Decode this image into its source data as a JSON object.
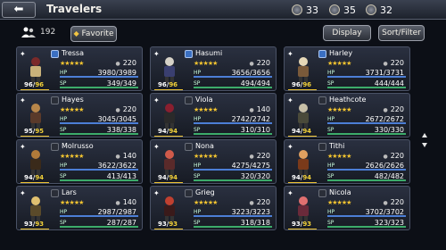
{
  "header": {
    "back_label": "⬅",
    "title": "Travelers",
    "resources": [
      {
        "name": "rank",
        "value": "33",
        "sub": "RANK"
      },
      {
        "name": "guild",
        "value": "35",
        "sub": "RANK"
      },
      {
        "name": "gems",
        "value": "32",
        "sub": "RANK"
      }
    ]
  },
  "toolbar": {
    "count": "192",
    "favorite_label": "Favorite",
    "display_label": "Display",
    "sort_label": "Sort/Filter"
  },
  "labels": {
    "hp": "HP",
    "sp": "SP"
  },
  "travelers": [
    {
      "name": "Tressa",
      "stars": "★★★★★",
      "level": "220",
      "lv": "96",
      "lvmax": "96",
      "hp": "3980/3989",
      "sp": "349/349",
      "weapon": "blue"
    },
    {
      "name": "Hasumi",
      "stars": "★★★★★",
      "level": "220",
      "lv": "96",
      "lvmax": "96",
      "hp": "3656/3656",
      "sp": "494/494",
      "weapon": "blue"
    },
    {
      "name": "Harley",
      "stars": "★★★★★",
      "level": "220",
      "lv": "96",
      "lvmax": "96",
      "hp": "3731/3731",
      "sp": "444/444",
      "weapon": "blue"
    },
    {
      "name": "Hayes",
      "stars": "★★★★★",
      "level": "220",
      "lv": "95",
      "lvmax": "95",
      "hp": "3045/3045",
      "sp": "338/338",
      "weapon": "dark"
    },
    {
      "name": "Viola",
      "stars": "★★★★★",
      "level": "140",
      "lv": "94",
      "lvmax": "94",
      "hp": "2742/2742",
      "sp": "310/310",
      "weapon": "dark"
    },
    {
      "name": "Heathcote",
      "stars": "★★★★★",
      "level": "220",
      "lv": "94",
      "lvmax": "94",
      "hp": "2672/2672",
      "sp": "330/330",
      "weapon": "dark"
    },
    {
      "name": "Molrusso",
      "stars": "★★★★★",
      "level": "140",
      "lv": "94",
      "lvmax": "94",
      "hp": "3622/3622",
      "sp": "413/413",
      "weapon": "dark"
    },
    {
      "name": "Nona",
      "stars": "★★★★★",
      "level": "220",
      "lv": "94",
      "lvmax": "94",
      "hp": "4275/4275",
      "sp": "320/320",
      "weapon": "dark"
    },
    {
      "name": "Tithi",
      "stars": "★★★★★",
      "level": "220",
      "lv": "94",
      "lvmax": "94",
      "hp": "2626/2626",
      "sp": "482/482",
      "weapon": "dark"
    },
    {
      "name": "Lars",
      "stars": "★★★★★",
      "level": "140",
      "lv": "93",
      "lvmax": "93",
      "hp": "2987/2987",
      "sp": "287/287",
      "weapon": "dark"
    },
    {
      "name": "Grieg",
      "stars": "★★★★★",
      "level": "220",
      "lv": "93",
      "lvmax": "93",
      "hp": "3223/3223",
      "sp": "318/318",
      "weapon": "dark"
    },
    {
      "name": "Nicola",
      "stars": "★★★★★",
      "level": "220",
      "lv": "93",
      "lvmax": "93",
      "hp": "3702/3702",
      "sp": "323/323",
      "weapon": "dark"
    }
  ]
}
